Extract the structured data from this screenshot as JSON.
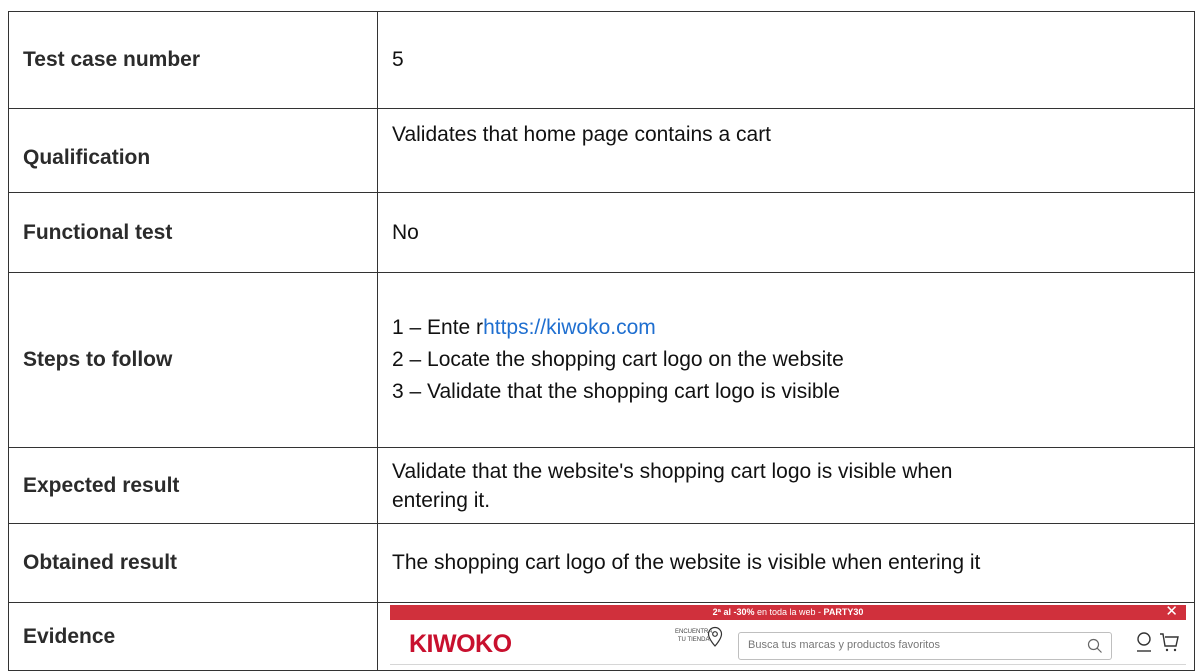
{
  "rows": [
    {
      "label": "Test case number",
      "value": "5"
    },
    {
      "label": "Qualification",
      "value": "Validates that home page contains a cart"
    },
    {
      "label": "Functional test",
      "value": "No"
    },
    {
      "label": "Steps to follow",
      "steps": {
        "s1_prefix": "1 – Ente r",
        "s1_link": "https://kiwoko.com",
        "s2": "2 – Locate the shopping cart logo on the website",
        "s3": "3 – Validate that the shopping cart logo is visible"
      }
    },
    {
      "label": "Expected result",
      "value_line1": "Validate that the website's shopping cart logo is visible when",
      "value_line2": "entering it."
    },
    {
      "label": "Obtained result",
      "value": "The shopping cart logo of the website is visible when entering it"
    },
    {
      "label": "Evidence"
    }
  ],
  "evidence": {
    "banner_bold1": "2ª al -30%",
    "banner_mid": " en toda la web ",
    "banner_sep": " - ",
    "banner_bold2": "PARTY30",
    "close": "✕",
    "logo": "KIWOKO",
    "store_line1": "ENCUENTRA",
    "store_line2": "TU TIENDA",
    "search_placeholder": "Busca tus marcas y productos favoritos",
    "icons": [
      "close-icon",
      "location-pin-icon",
      "search-icon",
      "user-icon",
      "cart-icon"
    ],
    "brand_color": "#c8102e",
    "banner_color": "#d0303c"
  }
}
